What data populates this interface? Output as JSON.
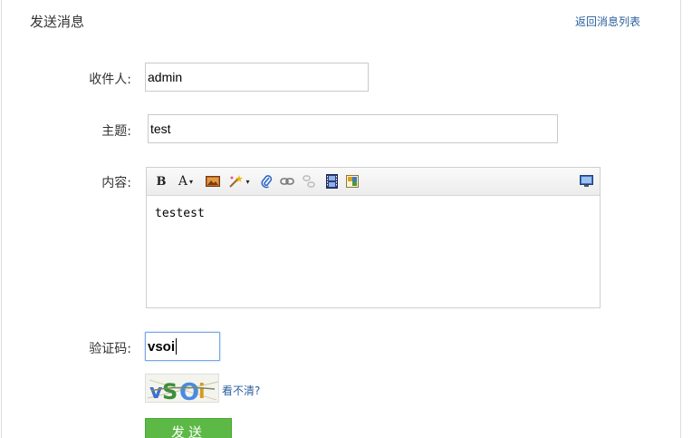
{
  "header": {
    "title": "发送消息",
    "back_link": "返回消息列表"
  },
  "form": {
    "recipient": {
      "label": "收件人:",
      "value": "admin"
    },
    "subject": {
      "label": "主题:",
      "value": "test"
    },
    "content": {
      "label": "内容:",
      "value": "testest",
      "toolbar": [
        "bold-icon",
        "font-color-icon",
        "image-icon",
        "magic-wand-icon",
        "attachment-icon",
        "link-icon",
        "unlink-icon",
        "video-icon",
        "media-icon",
        "fullscreen-icon"
      ]
    },
    "captcha": {
      "label": "验证码:",
      "value": "vsoi",
      "image_text": "vSOi",
      "refresh_label": "看不清?"
    },
    "submit_label": "发送"
  },
  "colors": {
    "link": "#2b5f9e",
    "submit": "#5cb945",
    "focus_border": "#7aa7e6"
  }
}
